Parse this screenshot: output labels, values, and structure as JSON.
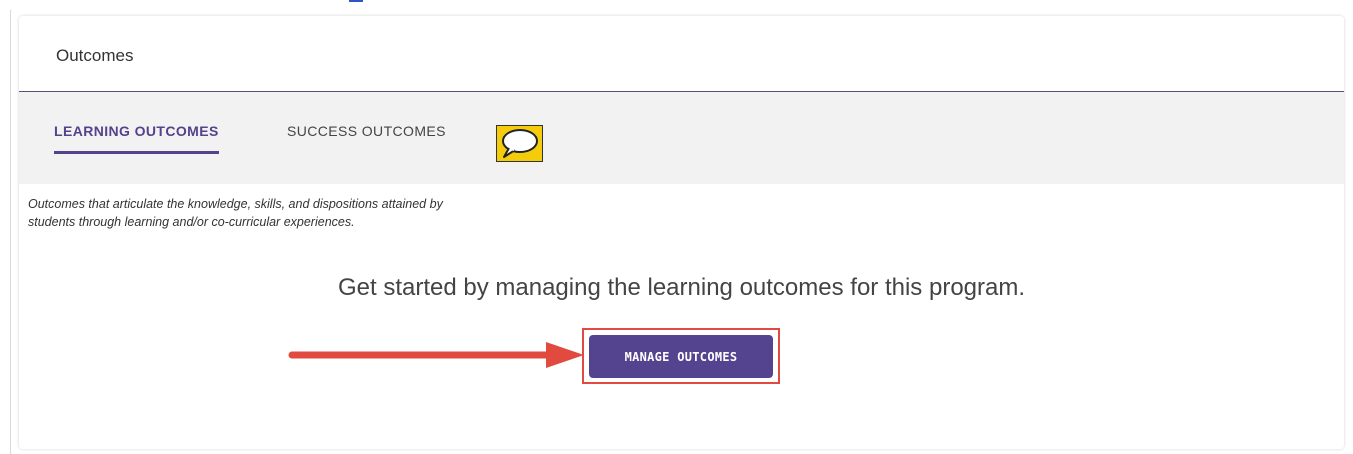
{
  "card": {
    "title": "Outcomes"
  },
  "tabs": [
    {
      "label": "LEARNING OUTCOMES",
      "active": true
    },
    {
      "label": "SUCCESS OUTCOMES",
      "active": false
    }
  ],
  "body": {
    "description_line1": "Outcomes that articulate the knowledge, skills, and dispositions attained by",
    "description_line2": "students through learning and/or co-curricular experiences.",
    "cta_text": "Get started by managing the learning outcomes for this program.",
    "button_label": "MANAGE OUTCOMES"
  },
  "annotations": {
    "comment_icon": "speech-bubble-icon",
    "arrow": "arrow-right-icon",
    "arrow_color": "#e04a3f",
    "highlight_color": "#e04a3f"
  },
  "colors": {
    "accent": "#55428c",
    "button": "#54448f",
    "comment_badge": "#f5cc0c"
  }
}
